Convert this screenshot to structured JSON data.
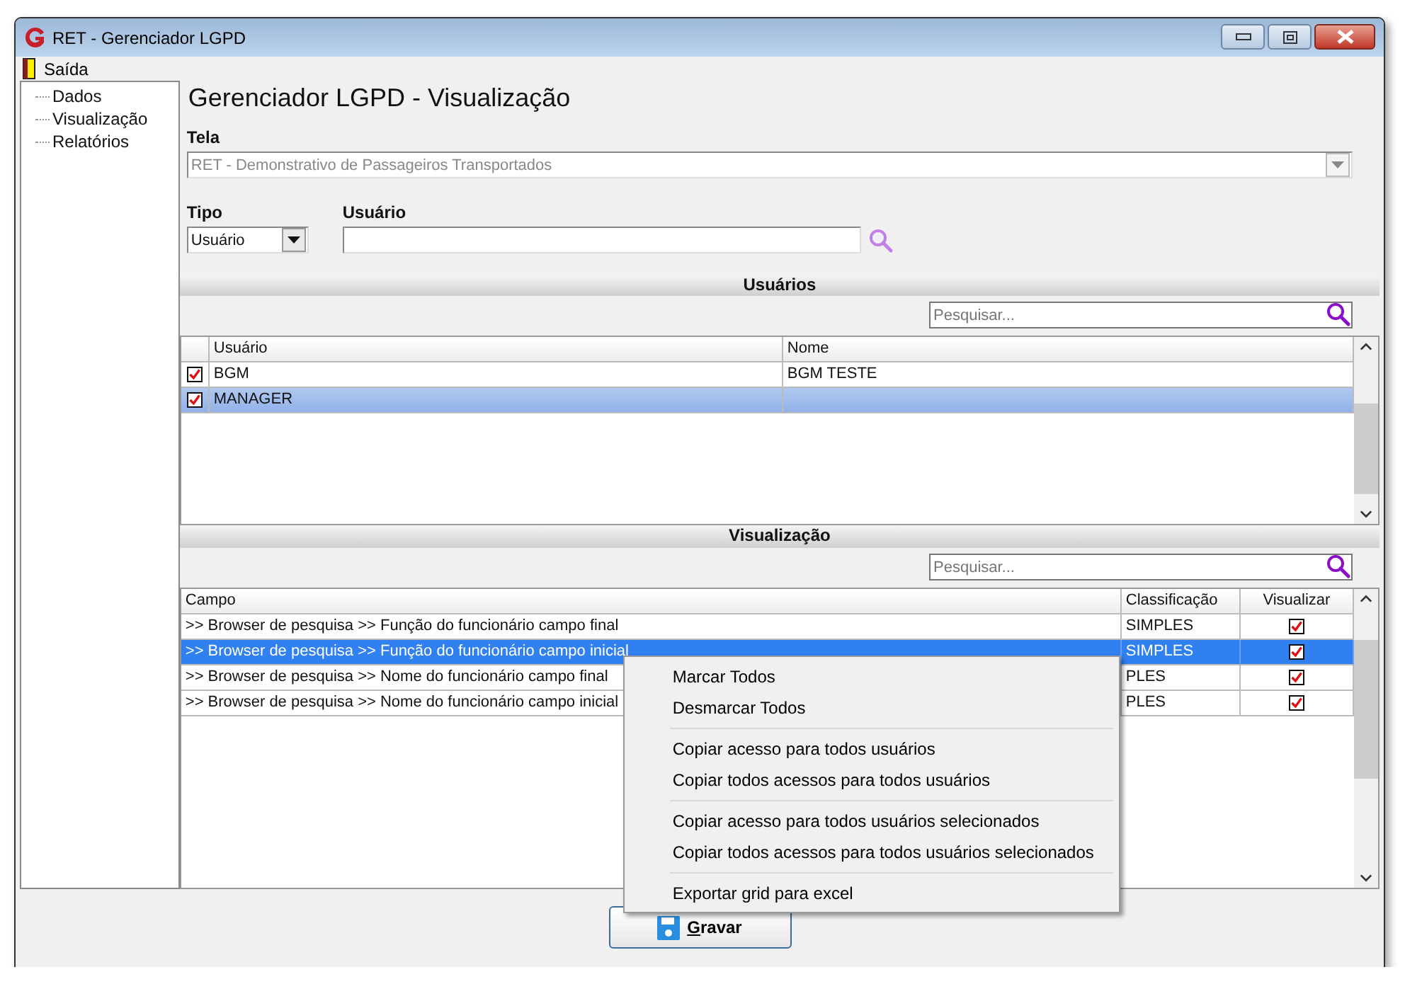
{
  "window": {
    "title": "RET - Gerenciador LGPD"
  },
  "menu": [
    {
      "label": "Saída"
    }
  ],
  "sidebar": {
    "items": [
      {
        "label": "Dados"
      },
      {
        "label": "Visualização"
      },
      {
        "label": "Relatórios"
      }
    ]
  },
  "page_title": "Gerenciador LGPD - Visualização",
  "tela": {
    "label": "Tela",
    "value": "RET -  Demonstrativo de Passageiros Transportados"
  },
  "tipo": {
    "label": "Tipo",
    "value": "Usuário"
  },
  "usuario": {
    "label": "Usuário"
  },
  "usuarios": {
    "title": "Usuários",
    "search_placeholder": "Pesquisar...",
    "columns": [
      "Usuário",
      "Nome"
    ],
    "rows": [
      {
        "usuario": "BGM",
        "nome": "BGM TESTE",
        "checked": true,
        "selected": false
      },
      {
        "usuario": "MANAGER",
        "checked": true,
        "selected": true
      }
    ]
  },
  "visualizacao": {
    "title": "Visualização",
    "search_placeholder": "Pesquisar...",
    "columns": [
      "Campo",
      "Classificação",
      "Visualizar"
    ],
    "rows": [
      {
        "campo": ">> Browser de pesquisa >> Função do funcionário campo final",
        "classificacao": "SIMPLES",
        "visualizar": true,
        "selected": false
      },
      {
        "campo": ">> Browser de pesquisa >> Função do funcionário campo inicial",
        "classificacao": "SIMPLES",
        "visualizar": true,
        "selected": true
      },
      {
        "campo": ">> Browser de pesquisa >> Nome do funcionário campo final",
        "classificacao": "PLES",
        "visualizar": true,
        "selected": false
      },
      {
        "campo": ">> Browser de pesquisa >> Nome do funcionário campo inicial",
        "classificacao": "PLES",
        "visualizar": true,
        "selected": false
      }
    ]
  },
  "context_menu": {
    "items": [
      {
        "kind": "item",
        "label": "Marcar Todos"
      },
      {
        "kind": "item",
        "label": "Desmarcar Todos"
      },
      {
        "kind": "separator"
      },
      {
        "kind": "item",
        "label": "Copiar acesso para todos usuários"
      },
      {
        "kind": "item",
        "label": "Copiar todos acessos para todos usuários"
      },
      {
        "kind": "separator"
      },
      {
        "kind": "item",
        "label": "Copiar acesso para todos usuários selecionados"
      },
      {
        "kind": "item",
        "label": "Copiar todos acessos para todos usuários selecionados"
      },
      {
        "kind": "separator"
      },
      {
        "kind": "item",
        "label": "Exportar grid para excel"
      }
    ]
  },
  "save_button": {
    "label": "Gravar"
  }
}
